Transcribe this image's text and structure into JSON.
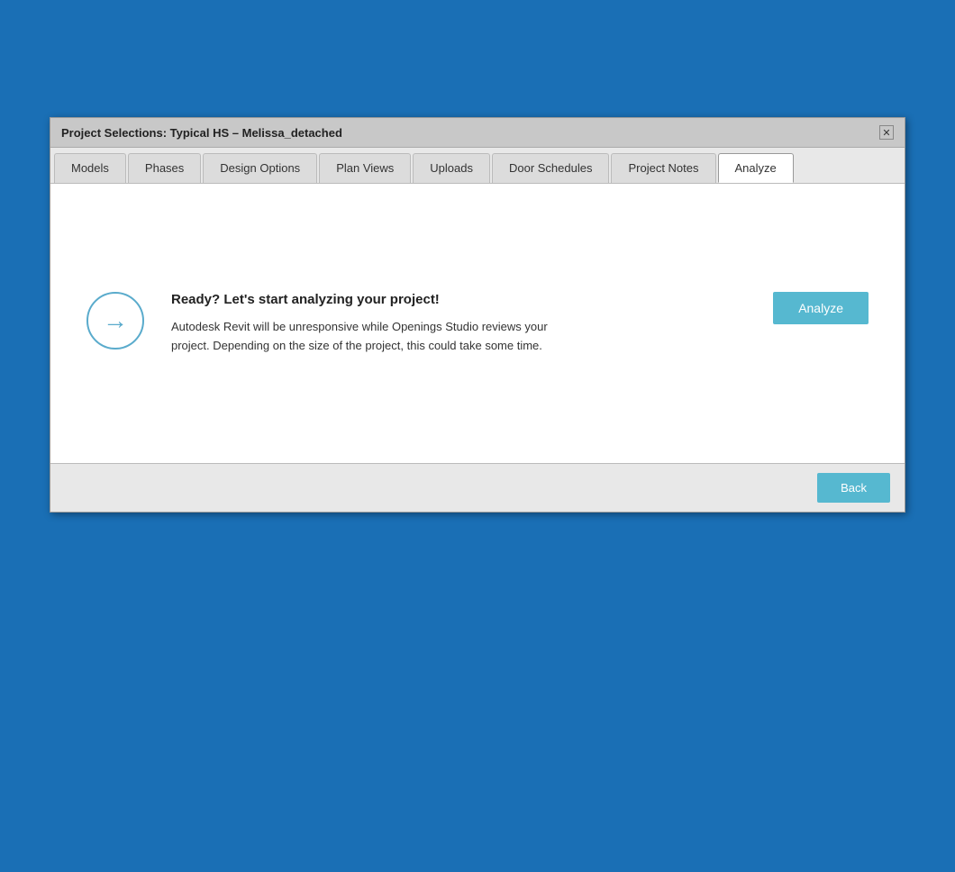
{
  "dialog": {
    "title_prefix": "Project Selections: ",
    "title_bold": "Typical HS – Melissa_detached"
  },
  "tabs": [
    {
      "id": "models",
      "label": "Models",
      "active": false
    },
    {
      "id": "phases",
      "label": "Phases",
      "active": false
    },
    {
      "id": "design-options",
      "label": "Design Options",
      "active": false
    },
    {
      "id": "plan-views",
      "label": "Plan Views",
      "active": false
    },
    {
      "id": "uploads",
      "label": "Uploads",
      "active": false
    },
    {
      "id": "door-schedules",
      "label": "Door Schedules",
      "active": false
    },
    {
      "id": "project-notes",
      "label": "Project Notes",
      "active": false
    },
    {
      "id": "analyze",
      "label": "Analyze",
      "active": true
    }
  ],
  "analyze": {
    "heading": "Ready? Let's start analyzing your project!",
    "description": "Autodesk Revit will be unresponsive while Openings Studio reviews your project. Depending on the size of the project, this could take some time.",
    "analyze_button_label": "Analyze",
    "arrow_icon_label": "→"
  },
  "footer": {
    "back_button_label": "Back"
  }
}
